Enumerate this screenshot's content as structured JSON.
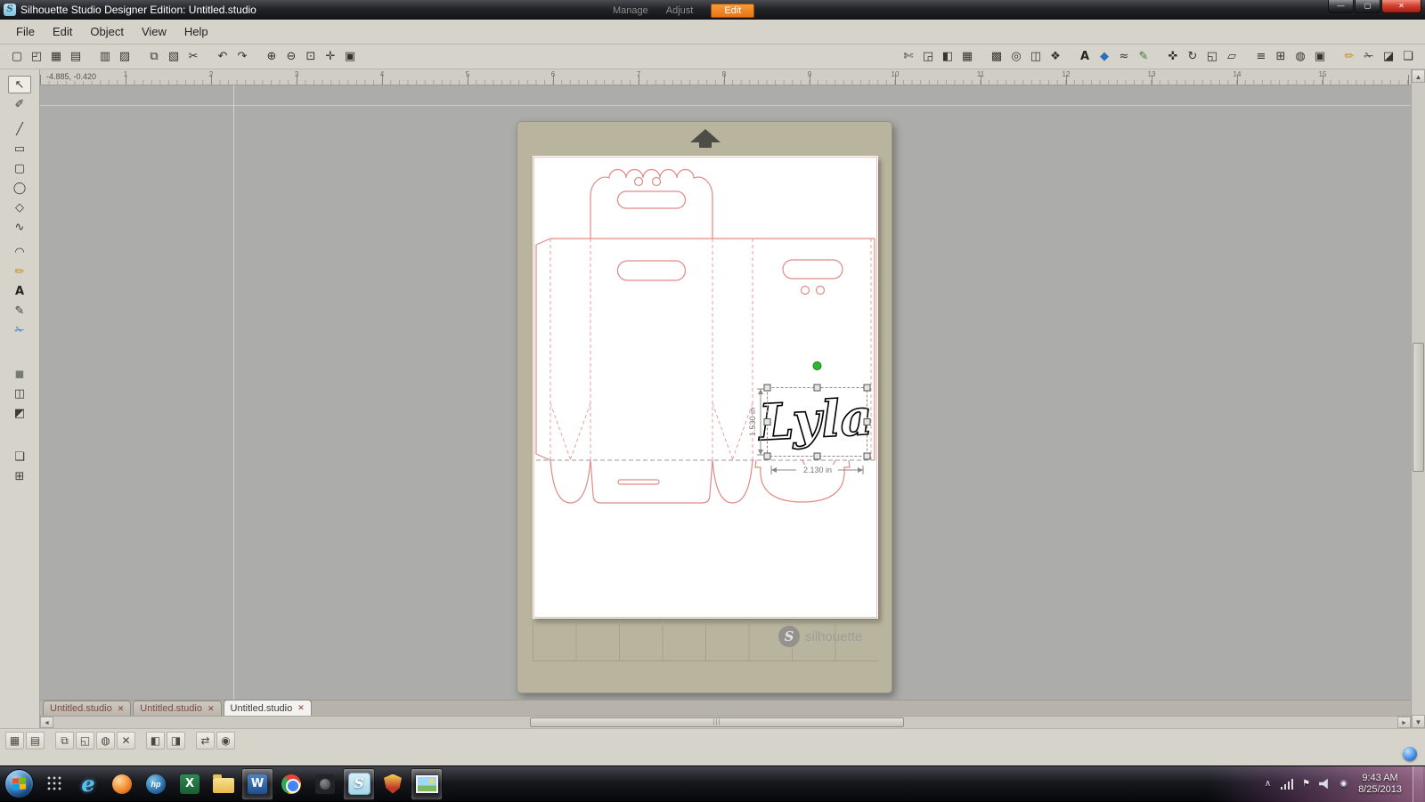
{
  "titlebar": {
    "title": "Silhouette Studio Designer Edition: Untitled.studio",
    "icon_letter": "S",
    "manage": "Manage",
    "adjust": "Adjust",
    "edit": "Edit",
    "minimize": "—",
    "maximize": "▢",
    "close": "✕"
  },
  "menubar": {
    "items": [
      {
        "name": "menu-file",
        "label": "File"
      },
      {
        "name": "menu-edit",
        "label": "Edit"
      },
      {
        "name": "menu-object",
        "label": "Object"
      },
      {
        "name": "menu-view",
        "label": "View"
      },
      {
        "name": "menu-help",
        "label": "Help"
      }
    ]
  },
  "toolbar": {
    "left": [
      {
        "name": "new-document-icon",
        "glyph": "▢"
      },
      {
        "name": "open-icon",
        "glyph": "◰"
      },
      {
        "name": "save-icon",
        "glyph": "▦"
      },
      {
        "name": "save-to-library-icon",
        "glyph": "▤"
      },
      {
        "name": "print-icon",
        "glyph": "▥",
        "sep": "sep"
      },
      {
        "name": "page-setup-icon",
        "glyph": "▨"
      },
      {
        "name": "copy-icon",
        "glyph": "⧉",
        "sep": "sep"
      },
      {
        "name": "paste-icon",
        "glyph": "▧"
      },
      {
        "name": "cut-icon",
        "glyph": "✂"
      },
      {
        "name": "undo-icon",
        "glyph": "↶",
        "sep": "sep"
      },
      {
        "name": "redo-icon",
        "glyph": "↷"
      },
      {
        "name": "zoom-in-icon",
        "glyph": "⊕",
        "sep": "sep"
      },
      {
        "name": "zoom-out-icon",
        "glyph": "⊖"
      },
      {
        "name": "zoom-selection-icon",
        "glyph": "⊡"
      },
      {
        "name": "pan-icon",
        "glyph": "✛"
      },
      {
        "name": "fit-to-page-icon",
        "glyph": "▣"
      }
    ],
    "right": [
      {
        "name": "cut-settings-icon",
        "glyph": "✄"
      },
      {
        "name": "registration-marks-icon",
        "glyph": "◲"
      },
      {
        "name": "page-settings-icon",
        "glyph": "◧"
      },
      {
        "name": "grid-settings-icon",
        "glyph": "▦"
      },
      {
        "name": "pixel-trace-icon",
        "glyph": "▩",
        "sep": "sep"
      },
      {
        "name": "offset-icon",
        "glyph": "◎"
      },
      {
        "name": "modify-icon",
        "glyph": "◫"
      },
      {
        "name": "object-edit-icon",
        "glyph": "❖"
      },
      {
        "name": "text-style-icon",
        "glyph": "A",
        "cls": "c-dark",
        "sep": "sep"
      },
      {
        "name": "fill-color-icon",
        "glyph": "◆",
        "cls": "c-blue"
      },
      {
        "name": "line-style-icon",
        "glyph": "≈"
      },
      {
        "name": "line-color-icon",
        "glyph": "✎",
        "cls": "c-green"
      },
      {
        "name": "move-icon",
        "glyph": "✜",
        "sep": "sep"
      },
      {
        "name": "rotate-icon",
        "glyph": "↻"
      },
      {
        "name": "scale-icon",
        "glyph": "◱"
      },
      {
        "name": "shear-icon",
        "glyph": "▱"
      },
      {
        "name": "align-icon",
        "glyph": "≡",
        "sep": "sep"
      },
      {
        "name": "replicate-icon",
        "glyph": "⊞"
      },
      {
        "name": "weld-icon",
        "glyph": "◍"
      },
      {
        "name": "group-options-icon",
        "glyph": "▣"
      },
      {
        "name": "sketch-pens-icon",
        "glyph": "✏",
        "cls": "c-yellow",
        "sep": "sep"
      },
      {
        "name": "knife-settings-icon",
        "glyph": "✁"
      },
      {
        "name": "eraser-settings-icon",
        "glyph": "◪"
      },
      {
        "name": "library-panel-icon",
        "glyph": "❏"
      }
    ]
  },
  "tools": {
    "items": [
      {
        "name": "select-tool",
        "glyph": "↖",
        "state": "active"
      },
      {
        "name": "edit-points-tool",
        "glyph": "✐"
      },
      {
        "name": "line-tool",
        "glyph": "╱",
        "sep": "sep"
      },
      {
        "name": "rectangle-tool",
        "glyph": "▭"
      },
      {
        "name": "rounded-rectangle-tool",
        "glyph": "▢"
      },
      {
        "name": "ellipse-tool",
        "glyph": "◯"
      },
      {
        "name": "polygon-tool",
        "glyph": "◇"
      },
      {
        "name": "curve-tool",
        "glyph": "∿"
      },
      {
        "name": "arc-tool",
        "glyph": "◠",
        "sep": "sep"
      },
      {
        "name": "freehand-tool",
        "glyph": "✏",
        "cls": "c-yellow"
      },
      {
        "name": "text-tool",
        "glyph": "A",
        "cls": "c-dark"
      },
      {
        "name": "note-tool",
        "glyph": "✎"
      },
      {
        "name": "knife-tool",
        "glyph": "✁",
        "cls": "c-blue"
      },
      {
        "name": "fill-tool",
        "glyph": "◼",
        "cls": "c-gray",
        "sep": "sep2"
      },
      {
        "name": "pattern-tool",
        "glyph": "◫"
      },
      {
        "name": "eraser-tool",
        "glyph": "◩"
      },
      {
        "name": "layers-tool",
        "glyph": "❏",
        "sep": "sep2"
      },
      {
        "name": "library-tool",
        "glyph": "⊞"
      }
    ]
  },
  "ruler": {
    "cursor": "-4.885, -0.420",
    "numbers": [
      "1",
      "2",
      "3",
      "4",
      "5",
      "6",
      "7",
      "8",
      "9",
      "10",
      "11",
      "12",
      "13",
      "14",
      "15"
    ]
  },
  "canvas": {
    "text_object": "Lyla",
    "dims": {
      "width_label": "2.130 in",
      "height_label": "1.530 in"
    },
    "watermark": {
      "s": "S",
      "label": "silhouette"
    }
  },
  "tabs": {
    "items": [
      {
        "label": "Untitled.studio",
        "close": "✕",
        "state": ""
      },
      {
        "label": "Untitled.studio",
        "close": "✕",
        "state": ""
      },
      {
        "label": "Untitled.studio",
        "close": "✕",
        "state": "active"
      }
    ]
  },
  "bottombar": {
    "items": [
      {
        "name": "make-compound-button",
        "glyph": "▦",
        "cls": "c-red"
      },
      {
        "name": "release-compound-button",
        "glyph": "▤",
        "cls": "c-red"
      },
      {
        "name": "group-button",
        "glyph": "⧉",
        "sep": "sep"
      },
      {
        "name": "ungroup-button",
        "glyph": "◱"
      },
      {
        "name": "weld-button",
        "glyph": "◍"
      },
      {
        "name": "intersect-button",
        "glyph": "✕"
      },
      {
        "name": "bring-to-front-button",
        "glyph": "◧",
        "sep": "sep"
      },
      {
        "name": "send-to-back-button",
        "glyph": "◨"
      },
      {
        "name": "mirror-button",
        "glyph": "⇄",
        "sep": "sep"
      },
      {
        "name": "rotate-button",
        "glyph": "◉",
        "cls": "c-red"
      }
    ]
  },
  "scroll": {
    "up": "▲",
    "down": "▼",
    "left": "◄",
    "right": "►",
    "grip": "|||"
  },
  "taskbar": {
    "items": [
      {
        "name": "app-grid-icon",
        "kind": "dots"
      },
      {
        "name": "internet-explorer-icon",
        "kind": "ie",
        "glyph": "e"
      },
      {
        "name": "media-player-icon",
        "kind": "media"
      },
      {
        "name": "hp-assistant-icon",
        "kind": "hp",
        "glyph": "hp"
      },
      {
        "name": "excel-icon",
        "kind": "excel",
        "glyph": "X"
      },
      {
        "name": "explorer-folder-icon",
        "kind": "folder"
      },
      {
        "name": "word-icon",
        "kind": "word",
        "glyph": "W",
        "open": "open"
      },
      {
        "name": "chrome-icon",
        "kind": "chrome"
      },
      {
        "name": "photo-app-icon",
        "kind": "photos"
      },
      {
        "name": "silhouette-studio-icon",
        "kind": "silhouette",
        "glyph": "S",
        "open": "open"
      },
      {
        "name": "security-app-icon",
        "kind": "shield"
      },
      {
        "name": "picture-viewer-icon",
        "kind": "pictures",
        "open": "open"
      }
    ],
    "tray": {
      "items": [
        {
          "name": "hidden-icons-button",
          "glyph": "∧"
        },
        {
          "name": "network-icon",
          "cls": "net"
        },
        {
          "name": "action-center-flag-icon",
          "glyph": "⚑"
        },
        {
          "name": "volume-icon",
          "cls": "vol"
        },
        {
          "name": "antivirus-icon",
          "glyph": "◉",
          "cls": "c-red"
        }
      ],
      "time": "9:43 AM",
      "date": "8/25/2013"
    }
  }
}
